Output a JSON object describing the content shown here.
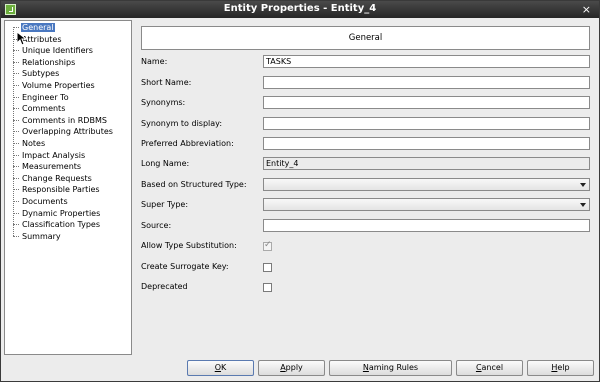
{
  "window": {
    "title": "Entity Properties - Entity_4"
  },
  "tree": {
    "items": [
      "General",
      "Attributes",
      "Unique Identifiers",
      "Relationships",
      "Subtypes",
      "Volume Properties",
      "Engineer To",
      "Comments",
      "Comments in RDBMS",
      "Overlapping Attributes",
      "Notes",
      "Impact Analysis",
      "Measurements",
      "Change Requests",
      "Responsible Parties",
      "Documents",
      "Dynamic Properties",
      "Classification Types",
      "Summary"
    ],
    "selected_index": 0
  },
  "panel": {
    "header": "General",
    "fields": {
      "name": {
        "label": "Name:",
        "value": "TASKS"
      },
      "short_name": {
        "label": "Short Name:",
        "value": ""
      },
      "synonyms": {
        "label": "Synonyms:",
        "value": ""
      },
      "synonym_display": {
        "label": "Synonym to display:",
        "value": ""
      },
      "preferred_abbr": {
        "label": "Preferred Abbreviation:",
        "value": ""
      },
      "long_name": {
        "label": "Long Name:",
        "value": "Entity_4"
      },
      "based_on": {
        "label": "Based on Structured Type:",
        "value": ""
      },
      "super_type": {
        "label": "Super Type:",
        "value": ""
      },
      "source": {
        "label": "Source:",
        "value": ""
      },
      "allow_type_sub": {
        "label": "Allow Type Substitution:",
        "checked": true
      },
      "create_surrogate": {
        "label": "Create Surrogate Key:",
        "checked": false
      },
      "deprecated": {
        "label": "Deprecated",
        "checked": false
      }
    }
  },
  "buttons": {
    "ok": {
      "u": "O",
      "rest": "K"
    },
    "apply": {
      "pre": "",
      "u": "A",
      "rest": "pply"
    },
    "naming": {
      "pre": "",
      "u": "N",
      "rest": "aming Rules"
    },
    "cancel": {
      "pre": "",
      "u": "C",
      "rest": "ancel"
    },
    "help": {
      "pre": "",
      "u": "H",
      "rest": "elp"
    }
  }
}
